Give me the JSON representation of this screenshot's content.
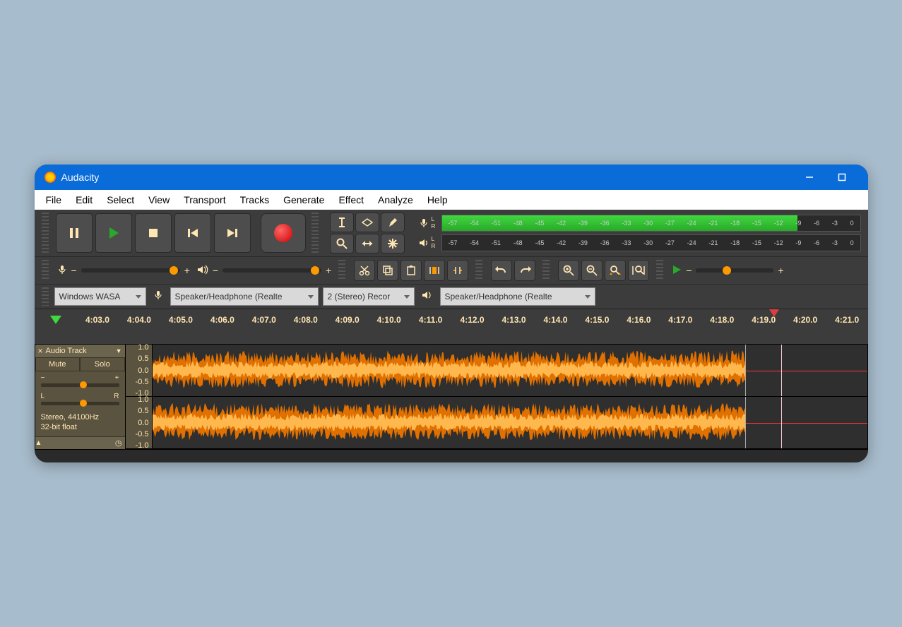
{
  "title": "Audacity",
  "menu": [
    "File",
    "Edit",
    "Select",
    "View",
    "Transport",
    "Tracks",
    "Generate",
    "Effect",
    "Analyze",
    "Help"
  ],
  "meter_ticks": [
    "-57",
    "-54",
    "-51",
    "-48",
    "-45",
    "-42",
    "-39",
    "-36",
    "-33",
    "-30",
    "-27",
    "-24",
    "-21",
    "-18",
    "-15",
    "-12",
    "-9",
    "-6",
    "-3",
    "0"
  ],
  "meter_lr": {
    "l": "L",
    "r": "R"
  },
  "slider": {
    "minus": "−",
    "plus": "+"
  },
  "device": {
    "host": "Windows WASA",
    "rec": "Speaker/Headphone (Realte",
    "chan": "2 (Stereo) Recor",
    "play": "Speaker/Headphone (Realte"
  },
  "timeline": [
    "4:03.0",
    "4:04.0",
    "4:05.0",
    "4:06.0",
    "4:07.0",
    "4:08.0",
    "4:09.0",
    "4:10.0",
    "4:11.0",
    "4:12.0",
    "4:13.0",
    "4:14.0",
    "4:15.0",
    "4:16.0",
    "4:17.0",
    "4:18.0",
    "4:19.0",
    "4:20.0",
    "4:21.0"
  ],
  "track": {
    "name": "Audio Track",
    "mute": "Mute",
    "solo": "Solo",
    "pan_l": "L",
    "pan_r": "R",
    "info1": "Stereo, 44100Hz",
    "info2": "32-bit float"
  },
  "vscale": {
    "p10": "1.0",
    "p05": "0.5",
    "z": "0.0",
    "n05": "-0.5",
    "n10": "-1.0"
  }
}
